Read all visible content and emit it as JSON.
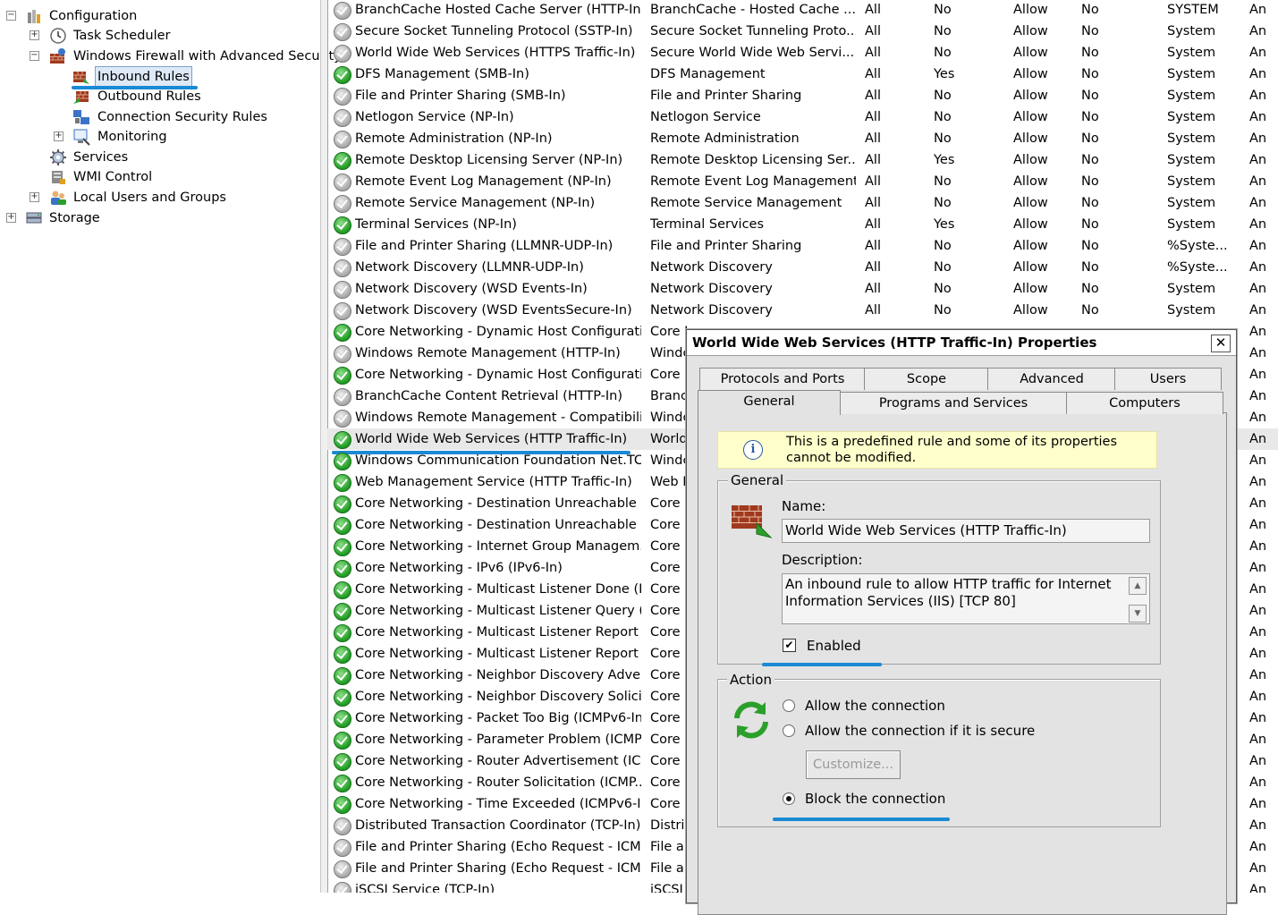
{
  "tree": {
    "configuration": "Configuration",
    "task_scheduler": "Task Scheduler",
    "windows_firewall": "Windows Firewall with Advanced Security",
    "inbound_rules": "Inbound Rules",
    "outbound_rules": "Outbound Rules",
    "connection_security_rules": "Connection Security Rules",
    "monitoring": "Monitoring",
    "services": "Services",
    "wmi_control": "WMI Control",
    "local_users": "Local Users and Groups",
    "storage": "Storage",
    "expand_plus": "+",
    "expand_minus": "−"
  },
  "rules": [
    {
      "enabled": false,
      "name": "BranchCache Hosted Cache Server (HTTP-In)",
      "group": "BranchCache - Hosted Cache ...",
      "profile": "All",
      "en": "No",
      "action": "Allow",
      "override": "No",
      "program": "SYSTEM",
      "last": "An"
    },
    {
      "enabled": false,
      "name": "Secure Socket Tunneling Protocol (SSTP-In)",
      "group": "Secure Socket Tunneling Proto...",
      "profile": "All",
      "en": "No",
      "action": "Allow",
      "override": "No",
      "program": "System",
      "last": "An"
    },
    {
      "enabled": false,
      "name": "World Wide Web Services (HTTPS Traffic-In)",
      "group": "Secure World Wide Web Servi...",
      "profile": "All",
      "en": "No",
      "action": "Allow",
      "override": "No",
      "program": "System",
      "last": "An"
    },
    {
      "enabled": true,
      "name": "DFS Management (SMB-In)",
      "group": "DFS Management",
      "profile": "All",
      "en": "Yes",
      "action": "Allow",
      "override": "No",
      "program": "System",
      "last": "An"
    },
    {
      "enabled": false,
      "name": "File and Printer Sharing (SMB-In)",
      "group": "File and Printer Sharing",
      "profile": "All",
      "en": "No",
      "action": "Allow",
      "override": "No",
      "program": "System",
      "last": "An"
    },
    {
      "enabled": false,
      "name": "Netlogon Service (NP-In)",
      "group": "Netlogon Service",
      "profile": "All",
      "en": "No",
      "action": "Allow",
      "override": "No",
      "program": "System",
      "last": "An"
    },
    {
      "enabled": false,
      "name": "Remote Administration (NP-In)",
      "group": "Remote Administration",
      "profile": "All",
      "en": "No",
      "action": "Allow",
      "override": "No",
      "program": "System",
      "last": "An"
    },
    {
      "enabled": true,
      "name": "Remote Desktop Licensing Server (NP-In)",
      "group": "Remote Desktop Licensing Ser...",
      "profile": "All",
      "en": "Yes",
      "action": "Allow",
      "override": "No",
      "program": "System",
      "last": "An"
    },
    {
      "enabled": false,
      "name": "Remote Event Log Management (NP-In)",
      "group": "Remote Event Log Management",
      "profile": "All",
      "en": "No",
      "action": "Allow",
      "override": "No",
      "program": "System",
      "last": "An"
    },
    {
      "enabled": false,
      "name": "Remote Service Management (NP-In)",
      "group": "Remote Service Management",
      "profile": "All",
      "en": "No",
      "action": "Allow",
      "override": "No",
      "program": "System",
      "last": "An"
    },
    {
      "enabled": true,
      "name": "Terminal Services (NP-In)",
      "group": "Terminal Services",
      "profile": "All",
      "en": "Yes",
      "action": "Allow",
      "override": "No",
      "program": "System",
      "last": "An"
    },
    {
      "enabled": false,
      "name": "File and Printer Sharing (LLMNR-UDP-In)",
      "group": "File and Printer Sharing",
      "profile": "All",
      "en": "No",
      "action": "Allow",
      "override": "No",
      "program": "%Syste...",
      "last": "An"
    },
    {
      "enabled": false,
      "name": "Network Discovery (LLMNR-UDP-In)",
      "group": "Network Discovery",
      "profile": "All",
      "en": "No",
      "action": "Allow",
      "override": "No",
      "program": "%Syste...",
      "last": "An"
    },
    {
      "enabled": false,
      "name": "Network Discovery (WSD Events-In)",
      "group": "Network Discovery",
      "profile": "All",
      "en": "No",
      "action": "Allow",
      "override": "No",
      "program": "System",
      "last": "An"
    },
    {
      "enabled": false,
      "name": "Network Discovery (WSD EventsSecure-In)",
      "group": "Network Discovery",
      "profile": "All",
      "en": "No",
      "action": "Allow",
      "override": "No",
      "program": "System",
      "last": "An"
    },
    {
      "enabled": true,
      "name": "Core Networking - Dynamic Host Configurati...",
      "group": "Core I",
      "profile": "",
      "en": "",
      "action": "",
      "override": "",
      "program": "",
      "last": "An"
    },
    {
      "enabled": false,
      "name": "Windows Remote Management (HTTP-In)",
      "group": "Windc",
      "profile": "",
      "en": "",
      "action": "",
      "override": "",
      "program": "",
      "last": "An"
    },
    {
      "enabled": true,
      "name": "Core Networking - Dynamic Host Configurati...",
      "group": "Core I",
      "profile": "",
      "en": "",
      "action": "",
      "override": "",
      "program": "",
      "last": "An"
    },
    {
      "enabled": false,
      "name": "BranchCache Content Retrieval (HTTP-In)",
      "group": "Branc",
      "profile": "",
      "en": "",
      "action": "",
      "override": "",
      "program": "",
      "last": "An"
    },
    {
      "enabled": false,
      "name": "Windows Remote Management - Compatibilit...",
      "group": "Windc",
      "profile": "",
      "en": "",
      "action": "",
      "override": "",
      "program": "",
      "last": "An"
    },
    {
      "enabled": true,
      "name": "World Wide Web Services (HTTP Traffic-In)",
      "group": "World",
      "profile": "",
      "en": "",
      "action": "",
      "override": "",
      "program": "",
      "last": "An",
      "selected": true
    },
    {
      "enabled": true,
      "name": "Windows Communication Foundation Net.TC...",
      "group": "Windc",
      "profile": "",
      "en": "",
      "action": "",
      "override": "",
      "program": "",
      "last": "An"
    },
    {
      "enabled": true,
      "name": "Web Management Service (HTTP Traffic-In)",
      "group": "Web I",
      "profile": "",
      "en": "",
      "action": "",
      "override": "",
      "program": "",
      "last": "An"
    },
    {
      "enabled": true,
      "name": "Core Networking - Destination Unreachable (...",
      "group": "Core I",
      "profile": "",
      "en": "",
      "action": "",
      "override": "",
      "program": "",
      "last": "An"
    },
    {
      "enabled": true,
      "name": "Core Networking - Destination Unreachable ...",
      "group": "Core I",
      "profile": "",
      "en": "",
      "action": "",
      "override": "",
      "program": "",
      "last": "An"
    },
    {
      "enabled": true,
      "name": "Core Networking - Internet Group Managem...",
      "group": "Core I",
      "profile": "",
      "en": "",
      "action": "",
      "override": "",
      "program": "",
      "last": "An"
    },
    {
      "enabled": true,
      "name": "Core Networking - IPv6 (IPv6-In)",
      "group": "Core I",
      "profile": "",
      "en": "",
      "action": "",
      "override": "",
      "program": "",
      "last": "An"
    },
    {
      "enabled": true,
      "name": "Core Networking - Multicast Listener Done (I...",
      "group": "Core I",
      "profile": "",
      "en": "",
      "action": "",
      "override": "",
      "program": "",
      "last": "An"
    },
    {
      "enabled": true,
      "name": "Core Networking - Multicast Listener Query (...",
      "group": "Core I",
      "profile": "",
      "en": "",
      "action": "",
      "override": "",
      "program": "",
      "last": "An"
    },
    {
      "enabled": true,
      "name": "Core Networking - Multicast Listener Report ...",
      "group": "Core I",
      "profile": "",
      "en": "",
      "action": "",
      "override": "",
      "program": "",
      "last": "An"
    },
    {
      "enabled": true,
      "name": "Core Networking - Multicast Listener Report ...",
      "group": "Core I",
      "profile": "",
      "en": "",
      "action": "",
      "override": "",
      "program": "",
      "last": "An"
    },
    {
      "enabled": true,
      "name": "Core Networking - Neighbor Discovery Adve...",
      "group": "Core I",
      "profile": "",
      "en": "",
      "action": "",
      "override": "",
      "program": "",
      "last": "An"
    },
    {
      "enabled": true,
      "name": "Core Networking - Neighbor Discovery Solicit...",
      "group": "Core I",
      "profile": "",
      "en": "",
      "action": "",
      "override": "",
      "program": "",
      "last": "An"
    },
    {
      "enabled": true,
      "name": "Core Networking - Packet Too Big (ICMPv6-In)",
      "group": "Core I",
      "profile": "",
      "en": "",
      "action": "",
      "override": "",
      "program": "",
      "last": "An"
    },
    {
      "enabled": true,
      "name": "Core Networking - Parameter Problem (ICMP...",
      "group": "Core I",
      "profile": "",
      "en": "",
      "action": "",
      "override": "",
      "program": "",
      "last": "An"
    },
    {
      "enabled": true,
      "name": "Core Networking - Router Advertisement (IC...",
      "group": "Core I",
      "profile": "",
      "en": "",
      "action": "",
      "override": "",
      "program": "",
      "last": "An"
    },
    {
      "enabled": true,
      "name": "Core Networking - Router Solicitation (ICMP...",
      "group": "Core I",
      "profile": "",
      "en": "",
      "action": "",
      "override": "",
      "program": "",
      "last": "An"
    },
    {
      "enabled": true,
      "name": "Core Networking - Time Exceeded (ICMPv6-In)",
      "group": "Core I",
      "profile": "",
      "en": "",
      "action": "",
      "override": "",
      "program": "",
      "last": "An"
    },
    {
      "enabled": false,
      "name": "Distributed Transaction Coordinator (TCP-In)",
      "group": "Distrib",
      "profile": "",
      "en": "",
      "action": "",
      "override": "",
      "program": "",
      "last": "An"
    },
    {
      "enabled": false,
      "name": "File and Printer Sharing (Echo Request - ICM...",
      "group": "File ar",
      "profile": "",
      "en": "",
      "action": "",
      "override": "",
      "program": "",
      "last": "An"
    },
    {
      "enabled": false,
      "name": "File and Printer Sharing (Echo Request - ICM...",
      "group": "File ar",
      "profile": "",
      "en": "",
      "action": "",
      "override": "",
      "program": "",
      "last": "An"
    },
    {
      "enabled": false,
      "name": "iSCSI Service (TCP-In)",
      "group": "iSCSI",
      "profile": "",
      "en": "",
      "action": "",
      "override": "",
      "program": "",
      "last": "An"
    }
  ],
  "dialog": {
    "title": "World Wide Web Services (HTTP Traffic-In) Properties",
    "close": "✕",
    "tabs_back": [
      "Protocols and Ports",
      "Scope",
      "Advanced",
      "Users"
    ],
    "tabs_front": [
      "General",
      "Programs and Services",
      "Computers"
    ],
    "info_icon": "i",
    "info_text": "This is a predefined rule and some of its properties cannot be modified.",
    "general_group": "General",
    "name_label": "Name:",
    "name_value": "World Wide Web Services (HTTP Traffic-In)",
    "description_label": "Description:",
    "description_value": "An inbound rule to allow HTTP traffic for Internet Information Services (IIS) [TCP 80]",
    "enabled_label": "Enabled",
    "enabled_checked": "✔",
    "action_group": "Action",
    "allow_label": "Allow the connection",
    "allow_secure_label": "Allow the connection if it is secure",
    "customize_label": "Customize...",
    "block_label": "Block the connection",
    "scroll_up": "▲",
    "scroll_down": "▼"
  },
  "colors": {
    "highlight_bar": "#1a8ad4",
    "enabled_icon": "#1e9a22",
    "disabled_icon": "#a8a8a8"
  }
}
